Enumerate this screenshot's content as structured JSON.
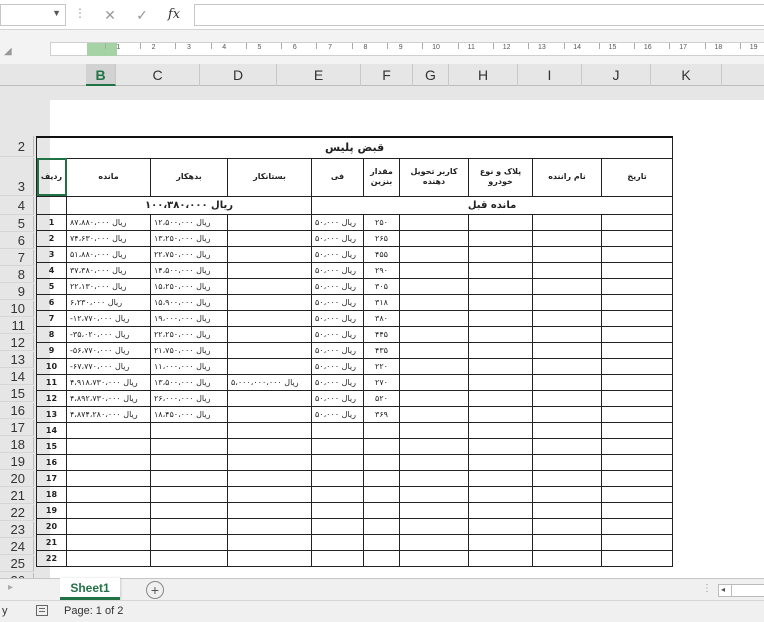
{
  "formula_bar": {
    "cancel": "✕",
    "enter": "✓",
    "fx": "fx",
    "value": ""
  },
  "ruler": {
    "numbers": [
      "1",
      "2",
      "3",
      "4",
      "5",
      "6",
      "7",
      "8",
      "9",
      "10",
      "11",
      "12",
      "13",
      "14",
      "15",
      "16",
      "17",
      "18",
      "19"
    ]
  },
  "columns": [
    "B",
    "C",
    "D",
    "E",
    "F",
    "G",
    "H",
    "I",
    "J",
    "K"
  ],
  "active_column": "B",
  "row_numbers": [
    "2",
    "3",
    "4",
    "5",
    "6",
    "7",
    "8",
    "9",
    "10",
    "11",
    "12",
    "13",
    "14",
    "15",
    "16",
    "17",
    "18",
    "19",
    "20",
    "21",
    "22",
    "23",
    "24",
    "25",
    "26"
  ],
  "table": {
    "title": "قبض پلیس",
    "headers": {
      "row_no": "ردیف",
      "balance": "مانده",
      "debit": "بدهکار",
      "credit": "بستانکار",
      "fi": "فی",
      "fuel_amount": "مقدار بنزین",
      "receiver": "کاربر تحویل دهنده",
      "plate": "پلاک و نوع خودرو",
      "driver": "نام راننده",
      "date": "تاریخ"
    },
    "previous_balance_label": "مانده قبل",
    "previous_balance_value": "ریال ۱۰۰،۳۸۰،۰۰۰",
    "rows": [
      {
        "no": "1",
        "balance": "ریال ۸۷،۸۸۰،۰۰۰",
        "debit": "ریال ۱۲،۵۰۰،۰۰۰",
        "credit": "",
        "fi": "ریال ۵۰،۰۰۰",
        "fuel": "۲۵۰"
      },
      {
        "no": "2",
        "balance": "ریال ۷۴،۶۳۰،۰۰۰",
        "debit": "ریال ۱۳،۲۵۰،۰۰۰",
        "credit": "",
        "fi": "ریال ۵۰،۰۰۰",
        "fuel": "۲۶۵"
      },
      {
        "no": "3",
        "balance": "ریال ۵۱،۸۸۰،۰۰۰",
        "debit": "ریال ۲۲،۷۵۰،۰۰۰",
        "credit": "",
        "fi": "ریال ۵۰،۰۰۰",
        "fuel": "۴۵۵"
      },
      {
        "no": "4",
        "balance": "ریال ۳۷،۳۸۰،۰۰۰",
        "debit": "ریال ۱۴،۵۰۰،۰۰۰",
        "credit": "",
        "fi": "ریال ۵۰،۰۰۰",
        "fuel": "۲۹۰"
      },
      {
        "no": "5",
        "balance": "ریال ۲۲،۱۳۰،۰۰۰",
        "debit": "ریال ۱۵،۲۵۰،۰۰۰",
        "credit": "",
        "fi": "ریال ۵۰،۰۰۰",
        "fuel": "۳۰۵"
      },
      {
        "no": "6",
        "balance": "ریال ۶،۲۳۰،۰۰۰",
        "debit": "ریال ۱۵،۹۰۰،۰۰۰",
        "credit": "",
        "fi": "ریال ۵۰،۰۰۰",
        "fuel": "۳۱۸"
      },
      {
        "no": "7",
        "balance": "ریال ۱۲،۷۷۰،۰۰۰-",
        "debit": "ریال ۱۹،۰۰۰،۰۰۰",
        "credit": "",
        "fi": "ریال ۵۰،۰۰۰",
        "fuel": "۳۸۰"
      },
      {
        "no": "8",
        "balance": "ریال ۳۵،۰۲۰،۰۰۰-",
        "debit": "ریال ۲۲،۲۵۰،۰۰۰",
        "credit": "",
        "fi": "ریال ۵۰،۰۰۰",
        "fuel": "۴۴۵"
      },
      {
        "no": "9",
        "balance": "ریال ۵۶،۷۷۰،۰۰۰-",
        "debit": "ریال ۲۱،۷۵۰،۰۰۰",
        "credit": "",
        "fi": "ریال ۵۰،۰۰۰",
        "fuel": "۴۳۵"
      },
      {
        "no": "10",
        "balance": "ریال ۶۷،۷۷۰،۰۰۰-",
        "debit": "ریال ۱۱،۰۰۰،۰۰۰",
        "credit": "",
        "fi": "ریال ۵۰،۰۰۰",
        "fuel": "۲۲۰"
      },
      {
        "no": "11",
        "balance": "ریال ۴،۹۱۸،۷۳۰،۰۰۰",
        "debit": "ریال ۱۳،۵۰۰،۰۰۰",
        "credit": "ریال ۵،۰۰۰،۰۰۰،۰۰۰",
        "fi": "ریال ۵۰،۰۰۰",
        "fuel": "۲۷۰"
      },
      {
        "no": "12",
        "balance": "ریال ۴،۸۹۲،۷۳۰،۰۰۰",
        "debit": "ریال ۲۶،۰۰۰،۰۰۰",
        "credit": "",
        "fi": "ریال ۵۰،۰۰۰",
        "fuel": "۵۲۰"
      },
      {
        "no": "13",
        "balance": "ریال ۴،۸۷۴،۲۸۰،۰۰۰",
        "debit": "ریال ۱۸،۴۵۰،۰۰۰",
        "credit": "",
        "fi": "ریال ۵۰،۰۰۰",
        "fuel": "۳۶۹"
      },
      {
        "no": "14",
        "balance": "",
        "debit": "",
        "credit": "",
        "fi": "",
        "fuel": ""
      },
      {
        "no": "15",
        "balance": "",
        "debit": "",
        "credit": "",
        "fi": "",
        "fuel": ""
      },
      {
        "no": "16",
        "balance": "",
        "debit": "",
        "credit": "",
        "fi": "",
        "fuel": ""
      },
      {
        "no": "17",
        "balance": "",
        "debit": "",
        "credit": "",
        "fi": "",
        "fuel": ""
      },
      {
        "no": "18",
        "balance": "",
        "debit": "",
        "credit": "",
        "fi": "",
        "fuel": ""
      },
      {
        "no": "19",
        "balance": "",
        "debit": "",
        "credit": "",
        "fi": "",
        "fuel": ""
      },
      {
        "no": "20",
        "balance": "",
        "debit": "",
        "credit": "",
        "fi": "",
        "fuel": ""
      },
      {
        "no": "21",
        "balance": "",
        "debit": "",
        "credit": "",
        "fi": "",
        "fuel": ""
      },
      {
        "no": "22",
        "balance": "",
        "debit": "",
        "credit": "",
        "fi": "",
        "fuel": ""
      }
    ]
  },
  "tabs": {
    "sheet": "Sheet1",
    "add": "+"
  },
  "status": {
    "ready": "y",
    "page_info": "Page: 1 of 2"
  },
  "colors": {
    "accent": "#217346",
    "grid": "#222222"
  }
}
